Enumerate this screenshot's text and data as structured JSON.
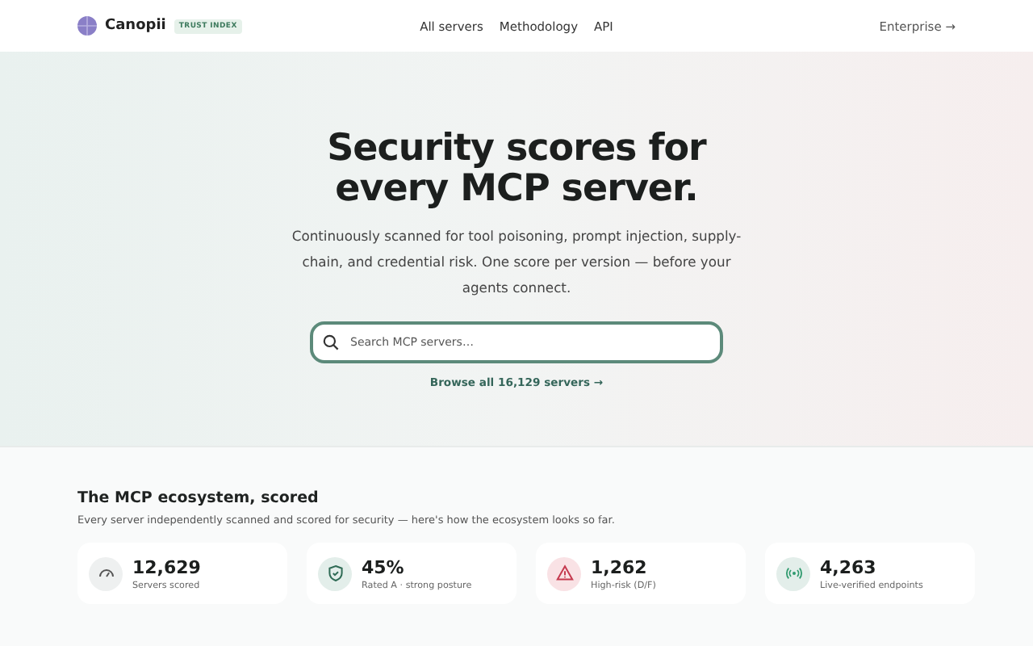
{
  "header": {
    "brand": "Canopii",
    "badge": "TRUST INDEX",
    "nav": [
      "All servers",
      "Methodology",
      "API"
    ],
    "cta": "Enterprise →"
  },
  "hero": {
    "title": "Security scores for every MCP server.",
    "subtitle": "Continuously scanned for tool poisoning, prompt injection, supply-chain, and credential risk. One score per version — before your agents connect.",
    "search": {
      "placeholder": "Search MCP servers…"
    },
    "browse_link": "Browse all 16,129 servers →"
  },
  "ecosystem": {
    "title": "The MCP ecosystem, scored",
    "subtitle": "Every server independently scanned and scored for security — here's how the ecosystem looks so far.",
    "stats": [
      {
        "kind": "gauge",
        "value": "12,629",
        "label": "Servers scored"
      },
      {
        "kind": "shield",
        "value": "45%",
        "label": "Rated A · strong posture"
      },
      {
        "kind": "warning",
        "value": "1,262",
        "label": "High-risk (D/F)"
      },
      {
        "kind": "signal",
        "value": "4,263",
        "label": "Live-verified endpoints"
      }
    ]
  }
}
